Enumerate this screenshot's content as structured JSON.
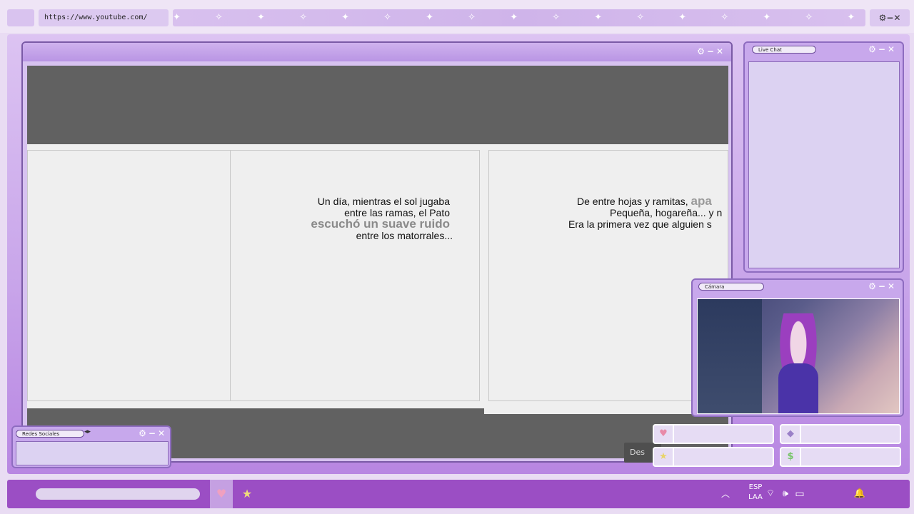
{
  "browser": {
    "url": "https://www.youtube.com/",
    "window_controls": "⚙−✕",
    "sparkles": "✦ ✧ ✦ ✧ ✦ ✧ ✦ ✧ ✦ ✧ ✦ ✧ ✦ ✧ ✦ ✧ ✦ ✧ ✦ ✧ ✦ ✧ ✦ ✧ ✦ ✧ ✦ ✧ ✦ ✧"
  },
  "main_window": {
    "controls": "⚙−✕"
  },
  "story": {
    "left_lines": [
      "Un día, mientras el sol jugaba",
      "entre las ramas, el Pato"
    ],
    "left_highlight": "escuchó un suave ruido",
    "left_last": "entre los matorrales...",
    "right_line1_a": "De entre hojas y ramitas, ",
    "right_line1_b": "apa",
    "right_line2": "Pequeña, hogareña... y n",
    "right_line3": "Era la primera vez que alguien s"
  },
  "player": {
    "button_label": "Des"
  },
  "chat_window": {
    "title": "Live Chat",
    "controls": "⚙−✕"
  },
  "camera_window": {
    "title": "Cámara",
    "controls": "⚙−✕"
  },
  "social_window": {
    "title": "Redes Sociales",
    "nav": "◂▸",
    "controls": "⚙−✕"
  },
  "social_buttons": [
    {
      "icon": "♥"
    },
    {
      "icon": "◆"
    },
    {
      "icon": "★"
    },
    {
      "icon": "$"
    }
  ],
  "taskbar": {
    "heart": "♥",
    "star": "★",
    "chevron": "︿",
    "lang_line1": "ESP",
    "lang_line2": "LAA",
    "wifi": "⌔",
    "volume": "🕪",
    "battery": "▭",
    "bell": "🔔"
  },
  "colors": {
    "accent": "#9b4ec4",
    "window_border": "#7a5aa6",
    "video_gray": "#616161",
    "page": "#efefef"
  }
}
